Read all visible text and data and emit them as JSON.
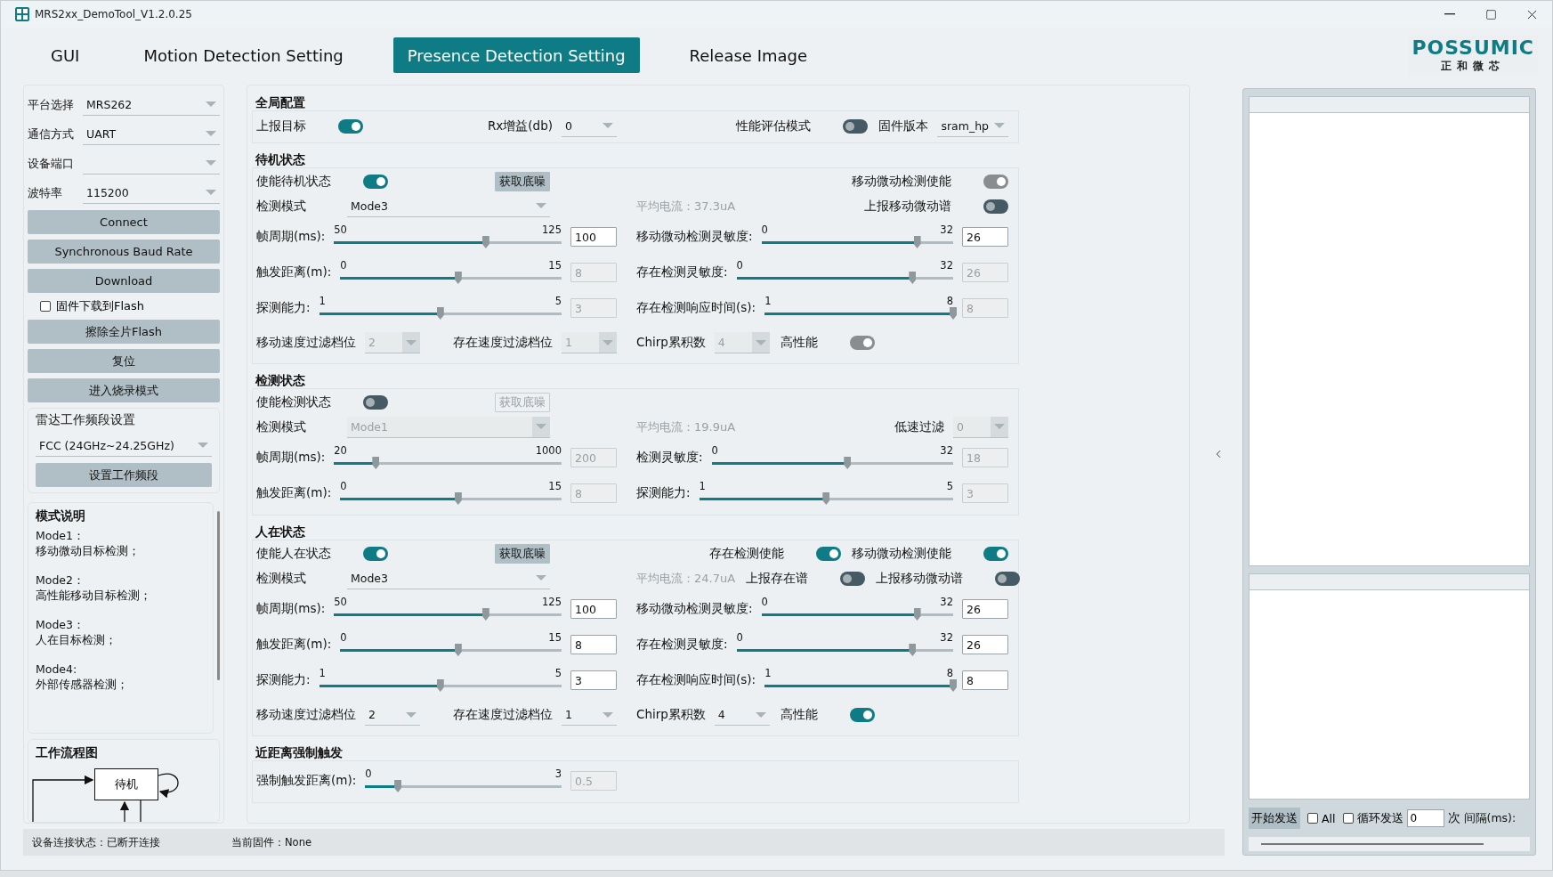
{
  "window": {
    "title": "MRS2xx_DemoTool_V1.2.0.25"
  },
  "tabs": [
    {
      "label": "GUI",
      "selected": false
    },
    {
      "label": "Motion Detection Setting",
      "selected": false
    },
    {
      "label": "Presence Detection Setting",
      "selected": true
    },
    {
      "label": "Release Image",
      "selected": false
    }
  ],
  "logo": {
    "name": "POSSUMIC",
    "subtitle": "正和微芯"
  },
  "connection": {
    "fields": [
      {
        "label": "平台选择",
        "value": "MRS262"
      },
      {
        "label": "通信方式",
        "value": "UART"
      },
      {
        "label": "设备端口"
      },
      {
        "label": "波特率",
        "value": "115200"
      }
    ],
    "buttons": [
      "Connect",
      "Synchronous Baud Rate",
      "Download"
    ],
    "flash_checkbox": {
      "label": "固件下载到Flash",
      "checked": false
    },
    "more_buttons": [
      "擦除全片Flash",
      "复位",
      "进入烧录模式"
    ],
    "band": {
      "title": "雷达工作频段设置",
      "value": "FCC (24GHz~24.25GHz)",
      "button": "设置工作频段"
    }
  },
  "mode_notes": {
    "title": "模式说明",
    "items": [
      {
        "mode": "Mode1：",
        "text": "移动微动目标检测；"
      },
      {
        "mode": "Mode2：",
        "text": "高性能移动目标检测；"
      },
      {
        "mode": "Mode3：",
        "text": "人在目标检测；"
      },
      {
        "mode": "Mode4:",
        "text": "外部传感器检测；"
      }
    ]
  },
  "flowchart": {
    "title": "工作流程图",
    "node": "待机"
  },
  "sections": [
    {
      "title": "全局配置",
      "rows": [
        {
          "left": [
            {
              "kind": "toggle",
              "label": "上报目标",
              "on": true,
              "disabled": false
            },
            {
              "kind": "select",
              "label": "Rx增益(db)",
              "value": "0",
              "disabled": false
            }
          ],
          "right": [
            {
              "kind": "toggle",
              "label": "性能评估模式",
              "on": false,
              "disabled": false
            },
            {
              "kind": "select",
              "label": "固件版本",
              "value": "sram_hp",
              "disabled": false
            }
          ]
        }
      ]
    },
    {
      "title": "待机状态",
      "rows": [
        {
          "left": [
            {
              "kind": "toggle",
              "label": "使能待机状态",
              "on": true,
              "disabled": false
            },
            {
              "kind": "button",
              "label": "获取底噪",
              "disabled": false
            }
          ],
          "right": [
            {
              "kind": "toggle",
              "label": "移动微动检测使能",
              "on": true,
              "disabled": true
            }
          ]
        },
        {
          "left": [
            {
              "kind": "select",
              "label": "检测模式",
              "value": "Mode3",
              "disabled": false
            }
          ],
          "right": [
            {
              "kind": "reading",
              "text": "平均电流：37.3uA"
            },
            {
              "kind": "toggle",
              "label": "上报移动微动谱",
              "on": false,
              "disabled": false
            }
          ]
        },
        {
          "left": [
            {
              "kind": "slider",
              "label": "帧周期(ms):",
              "min": "50",
              "max": "125",
              "level": 0.667,
              "value": "100",
              "disabled": false
            }
          ],
          "right": [
            {
              "kind": "slider",
              "label": "移动微动检测灵敏度:",
              "min": "0",
              "max": "32",
              "level": 0.8125,
              "value": "26",
              "disabled": false
            }
          ]
        },
        {
          "left": [
            {
              "kind": "slider",
              "label": "触发距离(m):",
              "min": "0",
              "max": "15",
              "level": 0.533,
              "value": "8",
              "disabled": true
            }
          ],
          "right": [
            {
              "kind": "slider",
              "label": "存在检测灵敏度:",
              "min": "0",
              "max": "32",
              "level": 0.8125,
              "value": "26",
              "disabled": true
            }
          ]
        },
        {
          "left": [
            {
              "kind": "slider",
              "label": "探测能力:",
              "min": "1",
              "max": "5",
              "level": 0.5,
              "value": "3",
              "disabled": true
            }
          ],
          "right": [
            {
              "kind": "slider",
              "label": "存在检测响应时间(s):",
              "min": "1",
              "max": "8",
              "level": 1,
              "value": "8",
              "disabled": true
            }
          ]
        },
        {
          "left": [
            {
              "kind": "select",
              "label": "移动速度过滤档位",
              "value": "2",
              "disabled": true
            },
            {
              "kind": "select",
              "label": "存在速度过滤档位",
              "value": "1",
              "disabled": true
            }
          ],
          "right": [
            {
              "kind": "select",
              "label": "Chirp累积数",
              "value": "4",
              "disabled": true
            },
            {
              "kind": "toggle",
              "label": "高性能",
              "on": true,
              "disabled": true
            }
          ]
        }
      ]
    },
    {
      "title": "检测状态",
      "rows": [
        {
          "left": [
            {
              "kind": "toggle",
              "label": "使能检测状态",
              "on": false,
              "disabled": false
            },
            {
              "kind": "button",
              "label": "获取底噪",
              "disabled": true
            }
          ],
          "right": []
        },
        {
          "left": [
            {
              "kind": "select",
              "label": "检测模式",
              "value": "Mode1",
              "disabled": true
            }
          ],
          "right": [
            {
              "kind": "reading",
              "text": "平均电流：19.9uA"
            },
            {
              "kind": "select",
              "label": "低速过滤",
              "value": "0",
              "disabled": true
            }
          ]
        },
        {
          "left": [
            {
              "kind": "slider",
              "label": "帧周期(ms):",
              "min": "20",
              "max": "1000",
              "level": 0.184,
              "value": "200",
              "disabled": true
            }
          ],
          "right": [
            {
              "kind": "slider",
              "label": "检测灵敏度:",
              "min": "0",
              "max": "32",
              "level": 0.5625,
              "value": "18",
              "disabled": true
            }
          ]
        },
        {
          "left": [
            {
              "kind": "slider",
              "label": "触发距离(m):",
              "min": "0",
              "max": "15",
              "level": 0.533,
              "value": "8",
              "disabled": true
            }
          ],
          "right": [
            {
              "kind": "slider",
              "label": "探测能力:",
              "min": "1",
              "max": "5",
              "level": 0.5,
              "value": "3",
              "disabled": true
            }
          ]
        }
      ]
    },
    {
      "title": "人在状态",
      "rows": [
        {
          "left": [
            {
              "kind": "toggle",
              "label": "使能人在状态",
              "on": true,
              "disabled": false
            },
            {
              "kind": "button",
              "label": "获取底噪",
              "disabled": false
            }
          ],
          "right": [
            {
              "kind": "toggle",
              "label": "存在检测使能",
              "on": true,
              "disabled": false
            },
            {
              "kind": "toggle",
              "label": "移动微动检测使能",
              "on": true,
              "disabled": false
            }
          ]
        },
        {
          "left": [
            {
              "kind": "select",
              "label": "检测模式",
              "value": "Mode3",
              "disabled": false
            }
          ],
          "right": [
            {
              "kind": "reading",
              "text": "平均电流：24.7uA"
            },
            {
              "kind": "toggle",
              "label": "上报存在谱",
              "on": false,
              "disabled": false
            },
            {
              "kind": "toggle",
              "label": "上报移动微动谱",
              "on": false,
              "disabled": false
            }
          ]
        },
        {
          "left": [
            {
              "kind": "slider",
              "label": "帧周期(ms):",
              "min": "50",
              "max": "125",
              "level": 0.667,
              "value": "100",
              "disabled": false
            }
          ],
          "right": [
            {
              "kind": "slider",
              "label": "移动微动检测灵敏度:",
              "min": "0",
              "max": "32",
              "level": 0.8125,
              "value": "26",
              "disabled": false
            }
          ]
        },
        {
          "left": [
            {
              "kind": "slider",
              "label": "触发距离(m):",
              "min": "0",
              "max": "15",
              "level": 0.533,
              "value": "8",
              "disabled": false
            }
          ],
          "right": [
            {
              "kind": "slider",
              "label": "存在检测灵敏度:",
              "min": "0",
              "max": "32",
              "level": 0.8125,
              "value": "26",
              "disabled": false
            }
          ]
        },
        {
          "left": [
            {
              "kind": "slider",
              "label": "探测能力:",
              "min": "1",
              "max": "5",
              "level": 0.5,
              "value": "3",
              "disabled": false
            }
          ],
          "right": [
            {
              "kind": "slider",
              "label": "存在检测响应时间(s):",
              "min": "1",
              "max": "8",
              "level": 1,
              "value": "8",
              "disabled": false
            }
          ]
        },
        {
          "left": [
            {
              "kind": "select",
              "label": "移动速度过滤档位",
              "value": "2",
              "disabled": false
            },
            {
              "kind": "select",
              "label": "存在速度过滤档位",
              "value": "1",
              "disabled": false
            }
          ],
          "right": [
            {
              "kind": "select",
              "label": "Chirp累积数",
              "value": "4",
              "disabled": false
            },
            {
              "kind": "toggle",
              "label": "高性能",
              "on": true,
              "disabled": false
            }
          ]
        }
      ]
    },
    {
      "title": "近距离强制触发",
      "rows": [
        {
          "left": [
            {
              "kind": "slider",
              "label": "强制触发距离(m):",
              "min": "0",
              "max": "3",
              "level": 0.167,
              "value": "0.5",
              "disabled": true
            }
          ],
          "right": []
        }
      ]
    }
  ],
  "log": {
    "send_button": "开始发送",
    "all": {
      "label": "All",
      "checked": false
    },
    "loop": {
      "label": "循环发送",
      "checked": false
    },
    "count": "0",
    "count_unit": "次",
    "interval_label": "间隔(ms):"
  },
  "status_bar": {
    "connection": "设备连接状态：已断开连接",
    "firmware": "当前固件：None"
  }
}
